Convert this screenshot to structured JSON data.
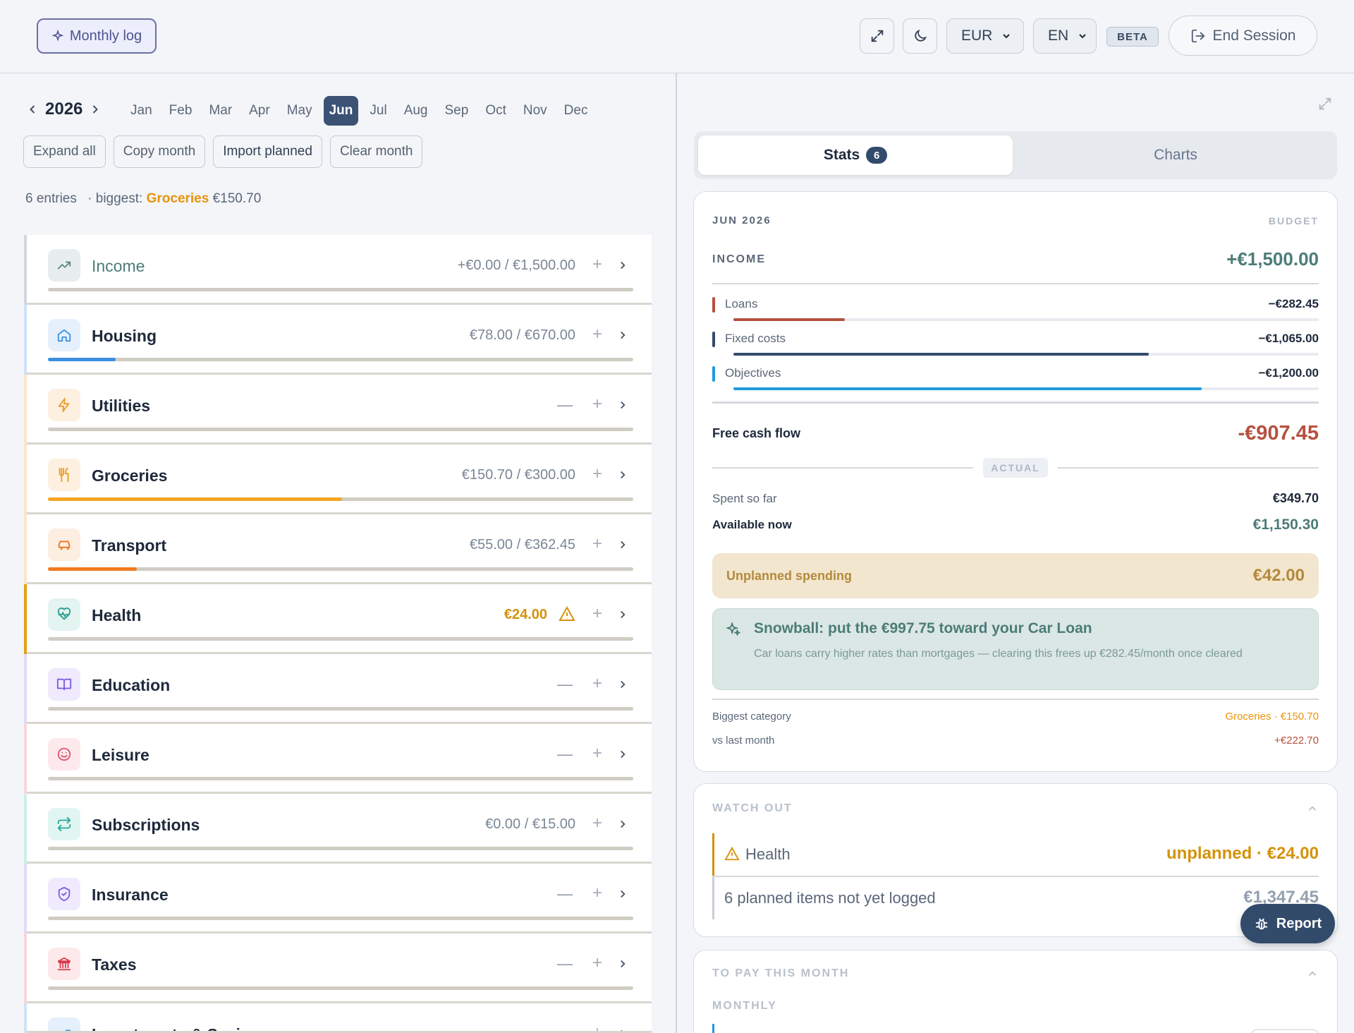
{
  "header": {
    "monthly_log": "Monthly log",
    "currency": "EUR",
    "language": "EN",
    "beta": "BETA",
    "end_session": "End Session"
  },
  "calendar": {
    "year": "2026",
    "months": [
      "Jan",
      "Feb",
      "Mar",
      "Apr",
      "May",
      "Jun",
      "Jul",
      "Aug",
      "Sep",
      "Oct",
      "Nov",
      "Dec"
    ],
    "active_month": "Jun"
  },
  "actions": {
    "expand_all": "Expand all",
    "copy_month": "Copy month",
    "import_planned": "Import planned",
    "clear_month": "Clear month"
  },
  "summary": {
    "entries": "6 entries",
    "biggest_prefix": "· biggest:",
    "biggest_name": "Groceries",
    "biggest_amount": "€150.70"
  },
  "categories": [
    {
      "name": "Income",
      "amount": "+€0.00 / €1,500.00",
      "progress": 0,
      "accent": "#d0d7dd",
      "icon": "trending-up-icon",
      "icon_color": "#5b8a86",
      "icon_bg": "#e8edee",
      "name_color": "#4c7c78"
    },
    {
      "name": "Housing",
      "amount": "€78.00 / €670.00",
      "progress": 0.116,
      "accent": "#cfe2f8",
      "icon": "home-icon",
      "icon_color": "#3b8fe0",
      "icon_bg": "#e5f0fc",
      "bar_color": "#3b8fe0"
    },
    {
      "name": "Utilities",
      "amount": "",
      "progress": 0,
      "accent": "#fbe6c7",
      "icon": "lightning-icon",
      "icon_color": "#f09a2a",
      "icon_bg": "#fdf0e0"
    },
    {
      "name": "Groceries",
      "amount": "€150.70 / €300.00",
      "progress": 0.502,
      "accent": "#fbe6c7",
      "icon": "utensils-icon",
      "icon_color": "#ef9a1e",
      "icon_bg": "#fdf0e0",
      "bar_color": "#f5a623"
    },
    {
      "name": "Transport",
      "amount": "€55.00 / €362.45",
      "progress": 0.152,
      "accent": "#fbe6c7",
      "icon": "car-icon",
      "icon_color": "#f0731e",
      "icon_bg": "#fdeee2",
      "bar_color": "#f27b1e"
    },
    {
      "name": "Health",
      "amount": "€24.00",
      "progress": 0,
      "accent": "#e2a21a",
      "icon": "heart-pulse-icon",
      "icon_color": "#2a9d90",
      "icon_bg": "#e3f4f1",
      "warning": true
    },
    {
      "name": "Education",
      "amount": "",
      "progress": 0,
      "accent": "#e2daf6",
      "icon": "book-icon",
      "icon_color": "#7c5ce0",
      "icon_bg": "#efeafd"
    },
    {
      "name": "Leisure",
      "amount": "",
      "progress": 0,
      "accent": "#f8d6dc",
      "icon": "smile-icon",
      "icon_color": "#e0566e",
      "icon_bg": "#fde9ec"
    },
    {
      "name": "Subscriptions",
      "amount": "€0.00 / €15.00",
      "progress": 0,
      "accent": "#cdeee8",
      "icon": "repeat-icon",
      "icon_color": "#27a89a",
      "icon_bg": "#e1f5f2"
    },
    {
      "name": "Insurance",
      "amount": "",
      "progress": 0,
      "accent": "#e2daf6",
      "icon": "shield-icon",
      "icon_color": "#7c5ce0",
      "icon_bg": "#efeafd"
    },
    {
      "name": "Taxes",
      "amount": "",
      "progress": 0,
      "accent": "#f8d6dc",
      "icon": "bank-icon",
      "icon_color": "#d93a4a",
      "icon_bg": "#fde9ec"
    },
    {
      "name": "Investments & Savings",
      "amount": "",
      "progress": 0,
      "accent": "#d0e3f5",
      "icon": "chart-icon",
      "icon_color": "#3b8fe0",
      "icon_bg": "#e5f0fc"
    }
  ],
  "tabs": {
    "stats": "Stats",
    "stats_count": "6",
    "charts": "Charts"
  },
  "budget": {
    "period": "JUN 2026",
    "label": "BUDGET",
    "income_label": "INCOME",
    "income_value": "+€1,500.00",
    "items": [
      {
        "label": "Loans",
        "value": "−€282.45",
        "share": 0.19,
        "color": "#b5513f"
      },
      {
        "label": "Fixed costs",
        "value": "−€1,065.00",
        "share": 0.71,
        "color": "#334b6b"
      },
      {
        "label": "Objectives",
        "value": "−€1,200.00",
        "share": 0.8,
        "color": "#1f9ae0"
      }
    ],
    "free_cash_flow_label": "Free cash flow",
    "free_cash_flow_value": "-€907.45",
    "actual_label": "ACTUAL",
    "spent_label": "Spent so far",
    "spent_value": "€349.70",
    "available_label": "Available now",
    "available_value": "€1,150.30",
    "unplanned_label": "Unplanned spending",
    "unplanned_value": "€42.00",
    "snowball_title": "Snowball: put the €997.75 toward your Car Loan",
    "snowball_text": "Car loans carry higher rates than mortgages — clearing this frees up €282.45/month once cleared",
    "biggest_label": "Biggest category",
    "biggest_value": "Groceries · €150.70",
    "vs_label": "vs last month",
    "vs_value": "+€222.70"
  },
  "watch_out": {
    "title": "WATCH OUT",
    "health_label": "Health",
    "health_value": "unplanned · €24.00",
    "planned_label": "6 planned items not yet logged",
    "planned_value": "€1,347.45"
  },
  "to_pay": {
    "title": "TO PAY THIS MONTH",
    "monthly": "MONTHLY"
  },
  "report": "Report",
  "colors": {
    "accent": "#334b6b",
    "income": "#4c7c78",
    "negative": "#b5513f",
    "warning": "#d4920a"
  }
}
